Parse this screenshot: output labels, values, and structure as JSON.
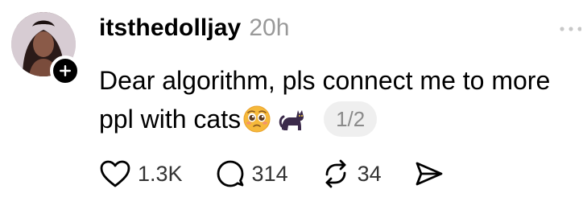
{
  "post": {
    "username": "itsthedolljay",
    "timestamp": "20h",
    "text_line1": "Dear algorithm, pls connect me to more",
    "text_line2": "ppl with cats",
    "emojis": [
      "pleading-face-emoji",
      "black-cat-emoji"
    ],
    "page_indicator": "1/2"
  },
  "actions": {
    "likes": "1.3K",
    "replies": "314",
    "reposts": "34"
  },
  "icons": [
    "plus-icon",
    "more-icon",
    "heart-icon",
    "comment-icon",
    "repost-icon",
    "share-icon"
  ],
  "colors": {
    "text": "#000000",
    "muted": "#999999",
    "badge_bg": "#efefef"
  }
}
